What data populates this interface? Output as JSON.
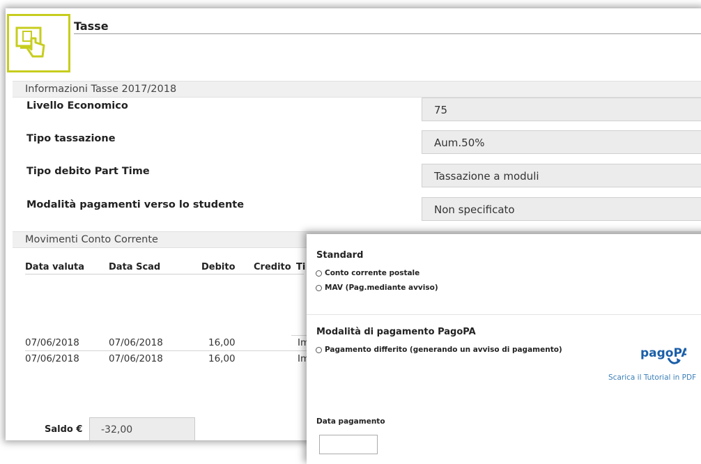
{
  "header": {
    "title": "Tasse"
  },
  "info_section": {
    "title": "Informazioni Tasse 2017/2018",
    "rows": [
      {
        "label": "Livello Economico",
        "value": "75"
      },
      {
        "label": "Tipo tassazione",
        "value": "Aum.50%"
      },
      {
        "label": "Tipo debito Part Time",
        "value": "Tassazione a moduli"
      },
      {
        "label": "Modalità pagamenti verso lo studente",
        "value": "Non specificato"
      }
    ]
  },
  "movements": {
    "title": "Movimenti Conto Corrente",
    "columns": [
      "Data valuta",
      "Data Scad",
      "Debito",
      "Credito",
      "Ti"
    ],
    "rows": [
      {
        "data_valuta": "07/06/2018",
        "data_scad": "07/06/2018",
        "debito": "16,00",
        "tipo": "Im"
      },
      {
        "data_valuta": "07/06/2018",
        "data_scad": "07/06/2018",
        "debito": "16,00",
        "tipo": "Im"
      }
    ],
    "saldo_label": "Saldo €",
    "saldo_value": "-32,00"
  },
  "payment": {
    "standard_title": "Standard",
    "standard_options": [
      "Conto corrente postale",
      "MAV (Pag.mediante avviso)"
    ],
    "pagopa_title": "Modalità di pagamento PagoPA",
    "pagopa_options": [
      "Pagamento differito (generando un avviso di pagamento)"
    ],
    "pagopa_logo_text": "pagoPA",
    "tutorial_link": "Scarica il Tutorial in PDF",
    "date_label": "Data pagamento",
    "date_value": ""
  },
  "colors": {
    "accent": "#c7cd1e",
    "link": "#3b7fb8",
    "pagopa": "#1a5ea8"
  },
  "icons": {
    "header": "touch-screen-icon",
    "pagopa": "pagopa-logo"
  }
}
